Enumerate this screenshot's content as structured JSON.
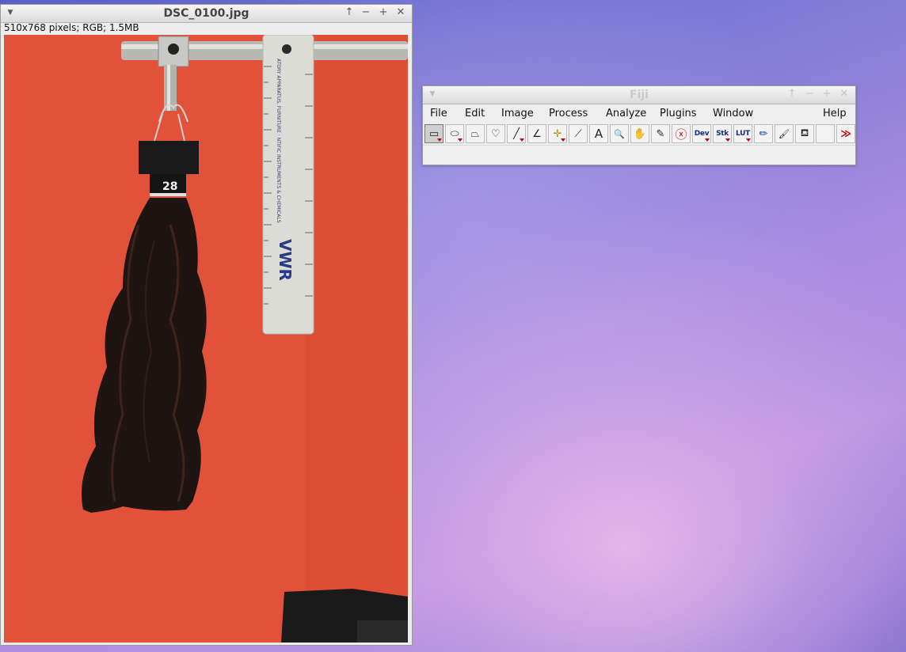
{
  "image_window": {
    "title": "DSC_0100.jpg",
    "info": "510x768 pixels; RGB; 1.5MB",
    "photo": {
      "ruler_text": "VWR",
      "ruler_subtext": "ATORY APPARATUS, FURNITURE · NTIFIC INSTRUMENTS & CHEMICALS",
      "tag_label": "28"
    }
  },
  "fiji_window": {
    "title": "Fiji",
    "menus": [
      "File",
      "Edit",
      "Image",
      "Process",
      "Analyze",
      "Plugins",
      "Window",
      "Help"
    ],
    "tools": [
      {
        "name": "rectangle-tool",
        "label": "▭",
        "selected": true
      },
      {
        "name": "oval-tool",
        "label": "⬭"
      },
      {
        "name": "polygon-tool",
        "label": "⏢"
      },
      {
        "name": "freehand-tool",
        "label": "♡"
      },
      {
        "name": "line-tool",
        "label": "╱"
      },
      {
        "name": "angle-tool",
        "label": "∠"
      },
      {
        "name": "point-tool",
        "label": "✛"
      },
      {
        "name": "wand-tool",
        "label": "⟋"
      },
      {
        "name": "text-tool",
        "label": "A"
      },
      {
        "name": "magnifier-tool",
        "label": "🔍"
      },
      {
        "name": "hand-tool",
        "label": "✋"
      },
      {
        "name": "dropper-tool",
        "label": "✎"
      },
      {
        "name": "close-tool",
        "label": "ⓧ"
      },
      {
        "name": "dev-tool",
        "label": "Dev"
      },
      {
        "name": "stk-tool",
        "label": "Stk"
      },
      {
        "name": "lut-tool",
        "label": "LUT"
      },
      {
        "name": "pencil-tool",
        "label": "✏"
      },
      {
        "name": "brush-tool",
        "label": "🖌"
      },
      {
        "name": "flood-fill-tool",
        "label": "⛾"
      },
      {
        "name": "empty-tool",
        "label": ""
      },
      {
        "name": "more-tools",
        "label": "≫"
      }
    ]
  },
  "colors": {
    "photo_background": "#e2523a",
    "desktop": "#8a78d8"
  }
}
